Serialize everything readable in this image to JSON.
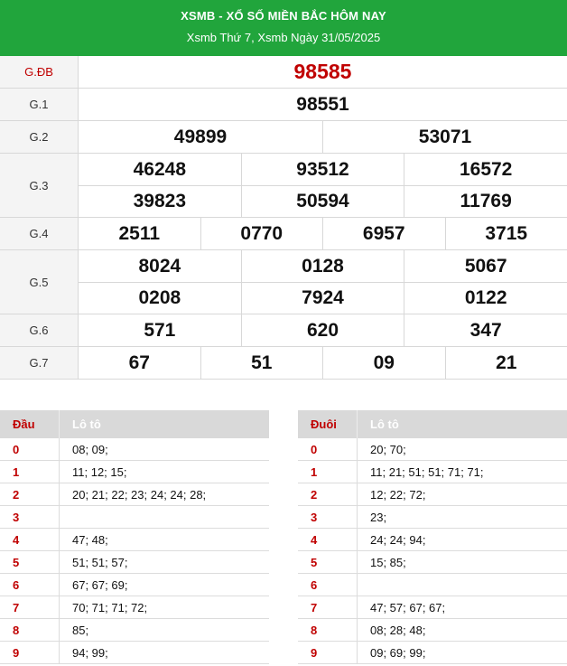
{
  "header": {
    "title": "XSMB - XỔ SỐ MIỀN BẮC HÔM NAY",
    "subtitle": "Xsmb Thứ 7, Xsmb Ngày 31/05/2025"
  },
  "prizes": [
    {
      "label": "G.ĐB",
      "lines": [
        [
          "98585"
        ]
      ]
    },
    {
      "label": "G.1",
      "lines": [
        [
          "98551"
        ]
      ]
    },
    {
      "label": "G.2",
      "lines": [
        [
          "49899",
          "53071"
        ]
      ]
    },
    {
      "label": "G.3",
      "lines": [
        [
          "46248",
          "93512",
          "16572"
        ],
        [
          "39823",
          "50594",
          "11769"
        ]
      ]
    },
    {
      "label": "G.4",
      "lines": [
        [
          "2511",
          "0770",
          "6957",
          "3715"
        ]
      ]
    },
    {
      "label": "G.5",
      "lines": [
        [
          "8024",
          "0128",
          "5067"
        ],
        [
          "0208",
          "7924",
          "0122"
        ]
      ]
    },
    {
      "label": "G.6",
      "lines": [
        [
          "571",
          "620",
          "347"
        ]
      ]
    },
    {
      "label": "G.7",
      "lines": [
        [
          "67",
          "51",
          "09",
          "21"
        ]
      ]
    }
  ],
  "loto_head": {
    "header_key": "Đầu",
    "header_values": "Lô tô",
    "rows": [
      {
        "key": "0",
        "values": "08; 09;"
      },
      {
        "key": "1",
        "values": "11; 12; 15;"
      },
      {
        "key": "2",
        "values": "20; 21; 22; 23; 24; 24; 28;"
      },
      {
        "key": "3",
        "values": ""
      },
      {
        "key": "4",
        "values": "47; 48;"
      },
      {
        "key": "5",
        "values": "51; 51; 57;"
      },
      {
        "key": "6",
        "values": "67; 67; 69;"
      },
      {
        "key": "7",
        "values": "70; 71; 71; 72;"
      },
      {
        "key": "8",
        "values": "85;"
      },
      {
        "key": "9",
        "values": "94; 99;"
      }
    ]
  },
  "loto_tail": {
    "header_key": "Đuôi",
    "header_values": "Lô tô",
    "rows": [
      {
        "key": "0",
        "values": "20; 70;"
      },
      {
        "key": "1",
        "values": "11; 21; 51; 51; 71; 71;"
      },
      {
        "key": "2",
        "values": "12; 22; 72;"
      },
      {
        "key": "3",
        "values": "23;"
      },
      {
        "key": "4",
        "values": "24; 24; 94;"
      },
      {
        "key": "5",
        "values": "15; 85;"
      },
      {
        "key": "6",
        "values": ""
      },
      {
        "key": "7",
        "values": "47; 57; 67; 67;"
      },
      {
        "key": "8",
        "values": "08; 28; 48;"
      },
      {
        "key": "9",
        "values": "09; 69; 99;"
      }
    ]
  },
  "colors": {
    "header_bg": "#21a53c",
    "special_red": "#c00000"
  }
}
